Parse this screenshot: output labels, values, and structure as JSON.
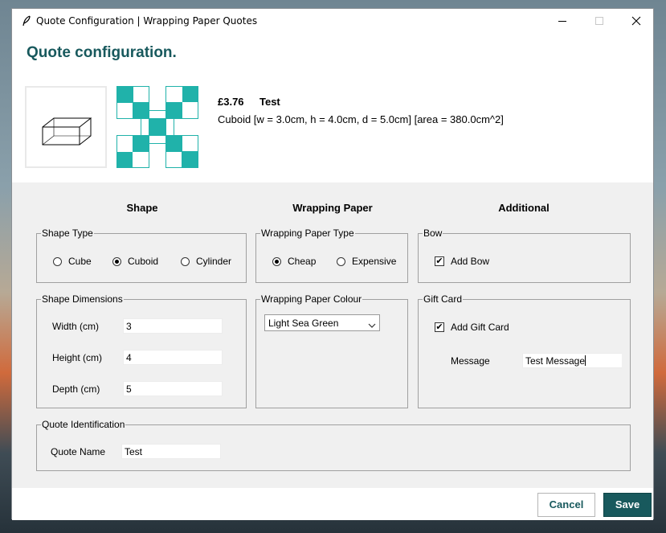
{
  "window": {
    "title": "Quote Configuration | Wrapping Paper Quotes"
  },
  "page": {
    "heading": "Quote configuration."
  },
  "summary": {
    "price": "£3.76",
    "quote_name": "Test",
    "description": "Cuboid [w = 3.0cm, h = 4.0cm, d = 5.0cm] [area = 380.0cm^2]"
  },
  "columns": {
    "shape": "Shape",
    "wrapping_paper": "Wrapping Paper",
    "additional": "Additional"
  },
  "shape_type": {
    "legend": "Shape Type",
    "options": [
      "Cube",
      "Cuboid",
      "Cylinder"
    ],
    "selected": "Cuboid"
  },
  "shape_dimensions": {
    "legend": "Shape Dimensions",
    "width_label": "Width (cm)",
    "width_value": "3",
    "height_label": "Height (cm)",
    "height_value": "4",
    "depth_label": "Depth (cm)",
    "depth_value": "5"
  },
  "paper_type": {
    "legend": "Wrapping Paper Type",
    "options": [
      "Cheap",
      "Expensive"
    ],
    "selected": "Cheap"
  },
  "paper_colour": {
    "legend": "Wrapping Paper Colour",
    "selected": "Light Sea Green",
    "color_hex": "#20b2aa"
  },
  "bow": {
    "legend": "Bow",
    "label": "Add Bow",
    "checked": true
  },
  "gift_card": {
    "legend": "Gift Card",
    "label": "Add Gift Card",
    "checked": true,
    "message_label": "Message",
    "message_value": "Test Message"
  },
  "quote_identification": {
    "legend": "Quote Identification",
    "name_label": "Quote Name",
    "name_value": "Test"
  },
  "footer": {
    "cancel_label": "Cancel",
    "save_label": "Save"
  },
  "colors": {
    "accent": "#18595d",
    "panel_bg": "#f0f0f0"
  },
  "icons": {
    "title": "feather-icon",
    "minimize": "minimize-icon",
    "maximize": "maximize-icon",
    "close": "close-icon",
    "dropdown": "chevron-down-icon"
  }
}
